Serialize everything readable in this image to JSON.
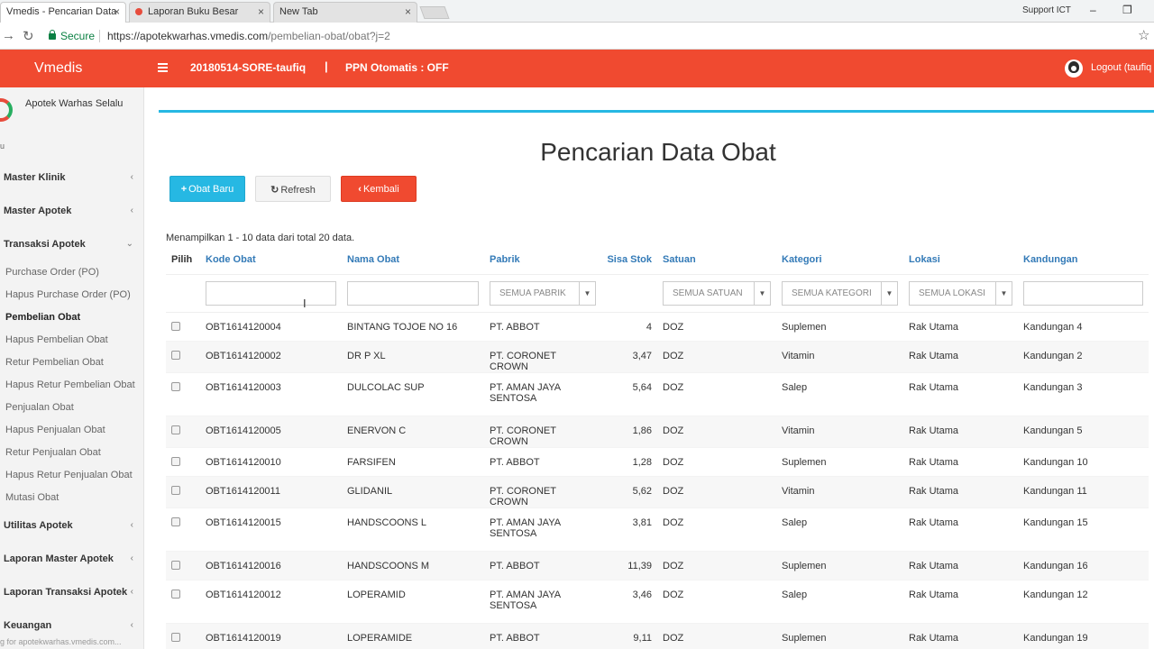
{
  "browser": {
    "tabs": [
      {
        "title": "Vmedis - Pencarian Data"
      },
      {
        "title": "Laporan Buku Besar"
      },
      {
        "title": "New Tab"
      }
    ],
    "close_glyph": "×",
    "window_label": "Support ICT",
    "secure_label": "Secure",
    "url_host": "https://apotekwarhas.vmedis.com",
    "url_path": "/pembelian-obat/obat?j=2",
    "status_url": "g for apotekwarhas.vmedis.com..."
  },
  "header": {
    "brand": "Vmedis",
    "session": "20180514-SORE-taufiq",
    "divider": "|",
    "ppn": "PPN Otomatis : OFF",
    "logout": "Logout (taufiq"
  },
  "sidebar": {
    "org_name": "Apotek Warhas Selalu",
    "user_initial": "u",
    "menus": [
      {
        "label": "Master Klinik",
        "chev": "‹"
      },
      {
        "label": "Master Apotek",
        "chev": "‹"
      },
      {
        "label": "Transaksi Apotek",
        "chev": "⌄"
      },
      {
        "label": "Utilitas Apotek",
        "chev": "‹"
      },
      {
        "label": "Laporan Master Apotek",
        "chev": "‹"
      },
      {
        "label": "Laporan Transaksi Apotek",
        "chev": "‹"
      },
      {
        "label": "Keuangan",
        "chev": "‹"
      }
    ],
    "submenu": [
      "Purchase Order (PO)",
      "Hapus Purchase Order (PO)",
      "Pembelian Obat",
      "Hapus Pembelian Obat",
      "Retur Pembelian Obat",
      "Hapus Retur Pembelian Obat",
      "Penjualan Obat",
      "Hapus Penjualan Obat",
      "Retur Penjualan Obat",
      "Hapus Retur Penjualan Obat",
      "Mutasi Obat"
    ]
  },
  "page": {
    "title": "Pencarian Data Obat",
    "btn_new": "Obat Baru",
    "btn_refresh": "Refresh",
    "btn_back": "Kembali",
    "summary": "Menampilkan 1 - 10 data dari total 20 data."
  },
  "table": {
    "headers": [
      "Pilih",
      "Kode Obat",
      "Nama Obat",
      "Pabrik",
      "Sisa Stok",
      "Satuan",
      "Kategori",
      "Lokasi",
      "Kandungan"
    ],
    "filters": {
      "pabrik": "SEMUA PABRIK",
      "satuan": "SEMUA SATUAN",
      "kategori": "SEMUA KATEGORI",
      "lokasi": "SEMUA LOKASI"
    },
    "rows": [
      {
        "kode": "OBT1614120004",
        "nama": "BINTANG TOJOE NO 16",
        "pabrik": "PT. ABBOT",
        "stok": "4",
        "satuan": "DOZ",
        "kategori": "Suplemen",
        "lokasi": "Rak Utama",
        "kandungan": "Kandungan 4"
      },
      {
        "kode": "OBT1614120002",
        "nama": "DR P XL",
        "pabrik": "PT. CORONET CROWN",
        "stok": "3,47",
        "satuan": "DOZ",
        "kategori": "Vitamin",
        "lokasi": "Rak Utama",
        "kandungan": "Kandungan 2"
      },
      {
        "kode": "OBT1614120003",
        "nama": "DULCOLAC SUP",
        "pabrik": "PT. AMAN JAYA SENTOSA",
        "stok": "5,64",
        "satuan": "DOZ",
        "kategori": "Salep",
        "lokasi": "Rak Utama",
        "kandungan": "Kandungan 3"
      },
      {
        "kode": "OBT1614120005",
        "nama": "ENERVON C",
        "pabrik": "PT. CORONET CROWN",
        "stok": "1,86",
        "satuan": "DOZ",
        "kategori": "Vitamin",
        "lokasi": "Rak Utama",
        "kandungan": "Kandungan 5"
      },
      {
        "kode": "OBT1614120010",
        "nama": "FARSIFEN",
        "pabrik": "PT. ABBOT",
        "stok": "1,28",
        "satuan": "DOZ",
        "kategori": "Suplemen",
        "lokasi": "Rak Utama",
        "kandungan": "Kandungan 10"
      },
      {
        "kode": "OBT1614120011",
        "nama": "GLIDANIL",
        "pabrik": "PT. CORONET CROWN",
        "stok": "5,62",
        "satuan": "DOZ",
        "kategori": "Vitamin",
        "lokasi": "Rak Utama",
        "kandungan": "Kandungan 11"
      },
      {
        "kode": "OBT1614120015",
        "nama": "HANDSCOONS L",
        "pabrik": "PT. AMAN JAYA SENTOSA",
        "stok": "3,81",
        "satuan": "DOZ",
        "kategori": "Salep",
        "lokasi": "Rak Utama",
        "kandungan": "Kandungan 15"
      },
      {
        "kode": "OBT1614120016",
        "nama": "HANDSCOONS M",
        "pabrik": "PT. ABBOT",
        "stok": "11,39",
        "satuan": "DOZ",
        "kategori": "Suplemen",
        "lokasi": "Rak Utama",
        "kandungan": "Kandungan 16"
      },
      {
        "kode": "OBT1614120012",
        "nama": "LOPERAMID",
        "pabrik": "PT. AMAN JAYA SENTOSA",
        "stok": "3,46",
        "satuan": "DOZ",
        "kategori": "Salep",
        "lokasi": "Rak Utama",
        "kandungan": "Kandungan 12"
      },
      {
        "kode": "OBT1614120019",
        "nama": "LOPERAMIDE",
        "pabrik": "PT. ABBOT",
        "stok": "9,11",
        "satuan": "DOZ",
        "kategori": "Suplemen",
        "lokasi": "Rak Utama",
        "kandungan": "Kandungan 19"
      }
    ]
  },
  "colors": {
    "header_bg": "#f04a30",
    "accent": "#26b8e3",
    "danger": "#f04a30",
    "link": "#337ab7"
  }
}
